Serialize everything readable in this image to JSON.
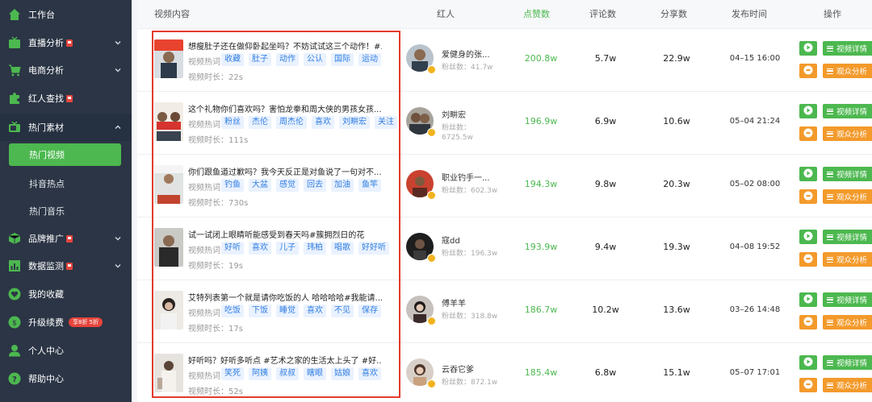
{
  "sidebar": {
    "items": [
      {
        "label": "工作台",
        "icon": "home-icon"
      },
      {
        "label": "直播分析",
        "icon": "live-tv-icon"
      },
      {
        "label": "电商分析",
        "icon": "cart-icon"
      },
      {
        "label": "红人查找",
        "icon": "puzzle-icon"
      },
      {
        "label": "热门素材",
        "icon": "tv-icon"
      },
      {
        "label": "品牌推广",
        "icon": "cube-icon"
      },
      {
        "label": "数据监测",
        "icon": "bar-chart-icon"
      },
      {
        "label": "我的收藏",
        "icon": "heart-icon"
      },
      {
        "label": "升级续费",
        "icon": "upgrade-icon"
      },
      {
        "label": "个人中心",
        "icon": "user-icon"
      },
      {
        "label": "帮助中心",
        "icon": "help-icon"
      }
    ],
    "sub_items": [
      "热门视频",
      "抖音热点",
      "热门音乐"
    ],
    "vip_badge": "享8折 5折"
  },
  "table": {
    "headers": {
      "content": "视频内容",
      "influencer": "红人",
      "likes": "点赞数",
      "comments": "评论数",
      "shares": "分享数",
      "publish_time": "发布时间",
      "actions": "操作"
    },
    "keyword_label": "视频热词",
    "duration_label": "视频时长：",
    "fans_label": "粉丝数：",
    "detail_button": "视频详情",
    "audience_button": "观众分析",
    "rows": [
      {
        "title": "想瘦肚子还在做仰卧起坐吗？不妨试试这三个动作！#...",
        "tags": [
          "收藏",
          "肚子",
          "动作",
          "公认",
          "国际",
          "运动"
        ],
        "duration": "22s",
        "influencer": "爱健身的张...",
        "fans": "41.7w",
        "likes": "200.8w",
        "comments": "5.7w",
        "shares": "22.9w",
        "date": "04–15 16:00"
      },
      {
        "title": "这个礼物你们喜欢吗？害怕龙拳和周大侠的男孩女孩...",
        "tags": [
          "粉丝",
          "杰伦",
          "周杰伦",
          "喜欢",
          "刘畊宏",
          "关注"
        ],
        "duration": "111s",
        "influencer": "刘畊宏",
        "fans": "6725.5w",
        "likes": "196.9w",
        "comments": "6.9w",
        "shares": "10.6w",
        "date": "05–04 21:24"
      },
      {
        "title": "你们跟鱼道过歉吗？我今天反正是对鱼说了一句对不...",
        "tags": [
          "钓鱼",
          "大盆",
          "感觉",
          "回去",
          "加油",
          "鱼竿"
        ],
        "duration": "730s",
        "influencer": "职业钓手一...",
        "fans": "602.3w",
        "likes": "194.3w",
        "comments": "9.8w",
        "shares": "20.3w",
        "date": "05–02 08:00"
      },
      {
        "title": "试一试闭上眼睛听能感受到春天吗#簇拥烈日的花",
        "tags": [
          "好听",
          "喜欢",
          "儿子",
          "玮柏",
          "唱歌",
          "好好听"
        ],
        "duration": "19s",
        "influencer": "寇dd",
        "fans": "196.3w",
        "likes": "193.9w",
        "comments": "9.4w",
        "shares": "19.3w",
        "date": "04–08 19:52"
      },
      {
        "title": "艾特列表第一个就是请你吃饭的人 哈哈哈哈#我能请...",
        "tags": [
          "吃饭",
          "下饭",
          "睡觉",
          "喜欢",
          "不见",
          "保存"
        ],
        "duration": "17s",
        "influencer": "傅羊羊",
        "fans": "318.8w",
        "likes": "186.7w",
        "comments": "10.2w",
        "shares": "13.6w",
        "date": "03–26 14:48"
      },
      {
        "title": "好听吗？好听多听点 #艺术之家的生活太上头了 #好...",
        "tags": [
          "笑死",
          "阿姨",
          "叔叔",
          "瞎眼",
          "姑娘",
          "喜欢"
        ],
        "duration": "52s",
        "influencer": "云吞它爹",
        "fans": "872.1w",
        "likes": "185.4w",
        "comments": "6.8w",
        "shares": "15.1w",
        "date": "05–07 17:01"
      }
    ]
  },
  "colors": {
    "sidebar_bg": "#2b3545",
    "accent_green": "#4cb84f",
    "accent_orange": "#f39a2b",
    "tag_blue": "#2f7de1",
    "highlight_red": "#e23b2e"
  }
}
